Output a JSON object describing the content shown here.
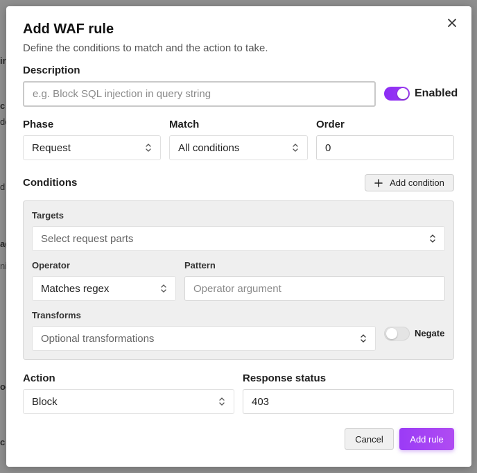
{
  "background": {
    "fragments": [
      "ir",
      "c",
      "dc",
      "d",
      "ag",
      "ni",
      "oc",
      "c"
    ]
  },
  "modal": {
    "title": "Add WAF rule",
    "subtitle": "Define the conditions to match and the action to take.",
    "description": {
      "label": "Description",
      "placeholder": "e.g. Block SQL injection in query string",
      "value": ""
    },
    "enabled": {
      "label": "Enabled",
      "on": true
    },
    "phase": {
      "label": "Phase",
      "value": "Request"
    },
    "match": {
      "label": "Match",
      "value": "All conditions"
    },
    "order": {
      "label": "Order",
      "value": "0"
    },
    "conditions": {
      "label": "Conditions",
      "add_button": "Add condition",
      "targets": {
        "label": "Targets",
        "placeholder": "Select request parts"
      },
      "operator": {
        "label": "Operator",
        "value": "Matches regex"
      },
      "pattern": {
        "label": "Pattern",
        "placeholder": "Operator argument"
      },
      "transforms": {
        "label": "Transforms",
        "placeholder": "Optional transformations"
      },
      "negate": {
        "label": "Negate",
        "on": false
      }
    },
    "action": {
      "label": "Action",
      "value": "Block"
    },
    "response_status": {
      "label": "Response status",
      "value": "403"
    },
    "footer": {
      "cancel": "Cancel",
      "submit": "Add rule"
    }
  },
  "colors": {
    "accent": "#9b3bf6",
    "overlay": "#8f8f8f"
  }
}
